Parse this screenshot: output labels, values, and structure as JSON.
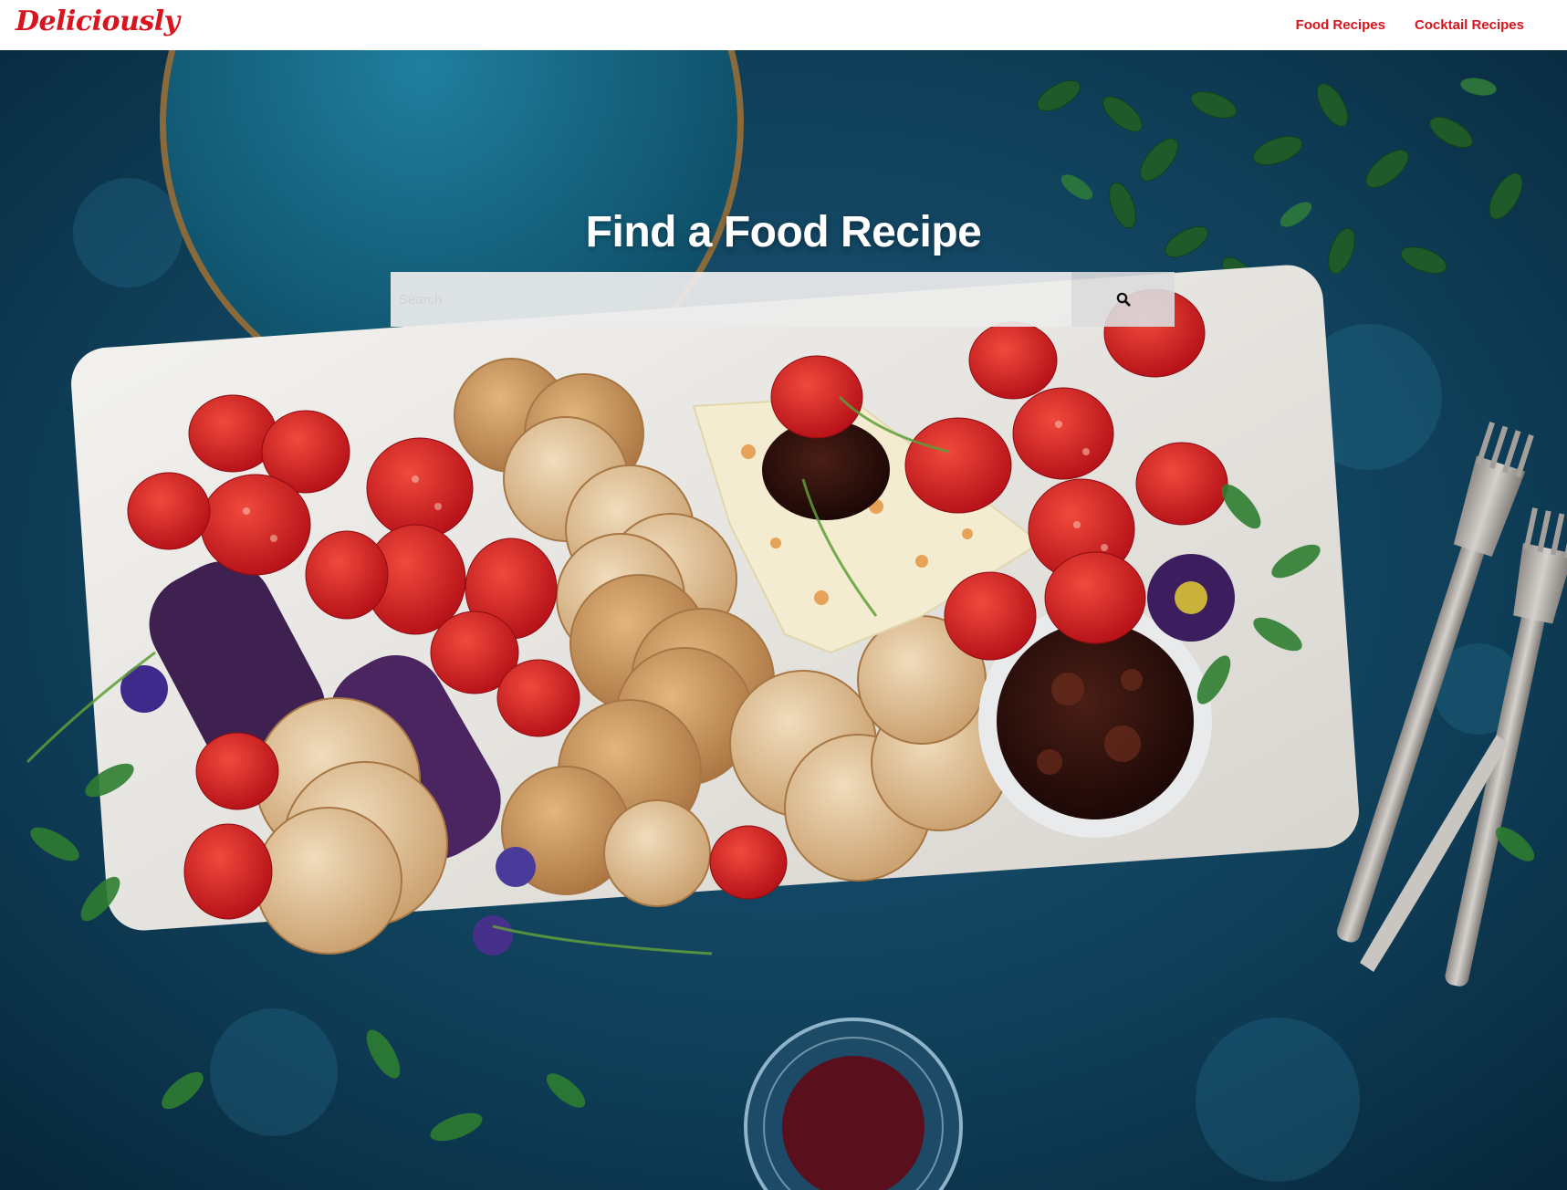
{
  "navbar": {
    "brand": "Deliciously",
    "links": [
      {
        "label": "Food Recipes"
      },
      {
        "label": "Cocktail Recipes"
      }
    ]
  },
  "hero": {
    "title": "Find a Food Recipe",
    "search": {
      "placeholder": "Search",
      "value": "",
      "button_icon": "search-icon"
    }
  },
  "colors": {
    "brand": "#d8141f",
    "hero_background": "#0f3a52",
    "navbar_background": "#ffffff",
    "title_text": "#ffffff"
  }
}
